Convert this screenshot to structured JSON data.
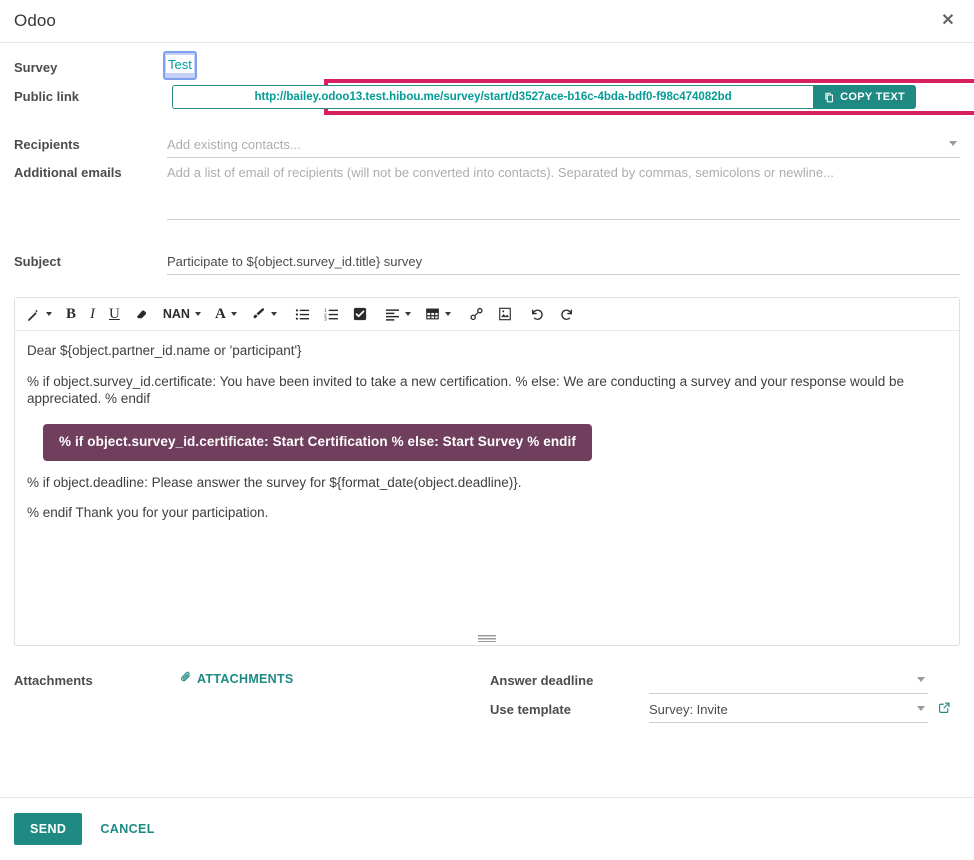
{
  "header": {
    "title": "Odoo",
    "close_label": "✕"
  },
  "form": {
    "survey": {
      "label": "Survey",
      "value": "Test"
    },
    "public_link": {
      "label": "Public link",
      "url": "http://bailey.odoo13.test.hibou.me/survey/start/d3527ace-b16c-4bda-bdf0-f98c474082bd",
      "copy_button": "COPY TEXT",
      "highlight_color": "#d6205f",
      "accent_color": "#1f8a84"
    },
    "recipients": {
      "label": "Recipients",
      "placeholder": "Add existing contacts...",
      "value": ""
    },
    "additional_emails": {
      "label": "Additional emails",
      "placeholder": "Add a list of email of recipients (will not be converted into contacts). Separated by commas, semicolons or newline...",
      "value": ""
    },
    "subject": {
      "label": "Subject",
      "value": "Participate to ${object.survey_id.title} survey"
    },
    "attachments": {
      "label": "Attachments",
      "button_label": "ATTACHMENTS"
    },
    "answer_deadline": {
      "label": "Answer deadline",
      "value": ""
    },
    "use_template": {
      "label": "Use template",
      "value": "Survey: Invite"
    }
  },
  "editor": {
    "toolbar": [
      {
        "name": "style-wand",
        "glyph": "✐",
        "type": "icon-caret"
      },
      {
        "name": "bold",
        "glyph": "B",
        "type": "bold"
      },
      {
        "name": "italic",
        "glyph": "I",
        "type": "italic"
      },
      {
        "name": "underline",
        "glyph": "U",
        "type": "underline"
      },
      {
        "name": "clear-format",
        "glyph": "▱",
        "type": "eraser"
      },
      {
        "name": "font-size",
        "glyph": "NAN",
        "type": "text-caret"
      },
      {
        "name": "font-color",
        "glyph": "A",
        "type": "letter-caret"
      },
      {
        "name": "background-color",
        "glyph": "✎",
        "type": "brush-caret"
      },
      {
        "name": "unordered-list",
        "glyph": "≡",
        "type": "icon"
      },
      {
        "name": "ordered-list",
        "glyph": "≣",
        "type": "icon"
      },
      {
        "name": "checklist",
        "glyph": "☑",
        "type": "icon"
      },
      {
        "name": "align",
        "glyph": "☰",
        "type": "icon-caret"
      },
      {
        "name": "table",
        "glyph": "⊞",
        "type": "icon-caret"
      },
      {
        "name": "link",
        "glyph": "ὑ7",
        "type": "icon"
      },
      {
        "name": "image",
        "glyph": "ὛC",
        "type": "icon"
      },
      {
        "name": "undo",
        "glyph": "↶",
        "type": "icon"
      },
      {
        "name": "redo",
        "glyph": "↷",
        "type": "icon"
      }
    ],
    "body": {
      "greeting": "Dear ${object.partner_id.name or 'participant'}",
      "intro": "% if object.survey_id.certificate: You have been invited to take a new certification. % else: We are conducting a survey and your response would be appreciated. % endif",
      "cta": "% if object.survey_id.certificate: Start Certification % else: Start Survey % endif",
      "cta_color": "#713f5e",
      "deadline": "% if object.deadline: Please answer the survey for ${format_date(object.deadline)}.",
      "closing": "% endif Thank you for your participation."
    }
  },
  "footer": {
    "send_label": "SEND",
    "cancel_label": "CANCEL"
  }
}
